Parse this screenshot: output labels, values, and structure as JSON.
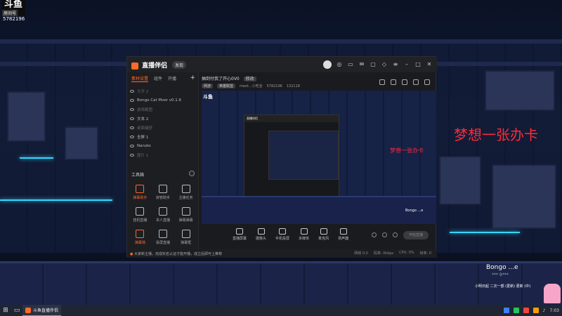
{
  "overlay": {
    "logo": "斗鱼",
    "logo_sub": "房间号",
    "room_id": "5782196",
    "dream_text": "梦想一张办卡",
    "bongo_name": "Bongo ...e",
    "bongo_sub": "*** 9***",
    "scroll_text": "小明日起 二次一部 (更新) 更新 (中)"
  },
  "app": {
    "name": "直播伴侣",
    "version_label": "发现",
    "titlebar_icons": [
      "avatar",
      "notice-icon",
      "chat-icon",
      "message-icon",
      "tv-icon",
      "skin-icon",
      "menu-icon",
      "minimize-icon",
      "maximize-icon",
      "close-icon"
    ],
    "left": {
      "tabs": [
        "素材设置",
        "组件",
        "开播"
      ],
      "add": "+",
      "sources": [
        {
          "label": "文字 2",
          "dim": true
        },
        {
          "label": "Bongo Cat Mver v0.1.6",
          "dim": false
        },
        {
          "label": "游戏截图",
          "dim": true
        },
        {
          "label": "文本 2",
          "dim": false
        },
        {
          "label": "桌面捕获",
          "dim": true
        },
        {
          "label": "全屏 1",
          "dim": false
        },
        {
          "label": "Naruko",
          "dim": false
        },
        {
          "label": "图片 1",
          "dim": true
        }
      ],
      "tools_title": "工具箱",
      "tools_more": "…",
      "tools": [
        {
          "label": "弹幕助手",
          "highlight": true
        },
        {
          "label": "房管助手",
          "highlight": false
        },
        {
          "label": "主播任务",
          "highlight": false
        },
        {
          "label": "挂机直播",
          "highlight": false
        },
        {
          "label": "本人直播",
          "highlight": false
        },
        {
          "label": "弹幕弹幕",
          "highlight": false
        },
        {
          "label": "弹幕墙",
          "highlight": true
        },
        {
          "label": "投屏直播",
          "highlight": false
        },
        {
          "label": "弹幕框",
          "highlight": false
        }
      ]
    },
    "main": {
      "title": "抽到付我了开心0V0",
      "edit": "修改",
      "row2": [
        "网游",
        "英雄联盟",
        "mext...小吃全",
        "5782196",
        "132118"
      ],
      "preview": {
        "inner_app": "直播伴侣",
        "logo": "斗鱼",
        "dream": "梦想一张办卡",
        "bongo": "Bongo ...e"
      },
      "controls": [
        "直播屏幕",
        "摄像头",
        "手机投屏",
        "多媒体",
        "麦克风",
        "扬声器"
      ],
      "start_button": "开始直播",
      "status_items": [
        "网络 0.0",
        "码率: 0kbps",
        "CPU: 0%",
        "帧率: 0"
      ]
    },
    "notice": "大家新主播，完成实名认证才能开播，成立后即可上推荐"
  },
  "taskbar": {
    "app_label": "斗鱼直播伴侣",
    "time": "7:03"
  },
  "colors": {
    "accent": "#ff6a2a",
    "dream_red": "#ff2a3a",
    "neon": "#37d6ff"
  }
}
